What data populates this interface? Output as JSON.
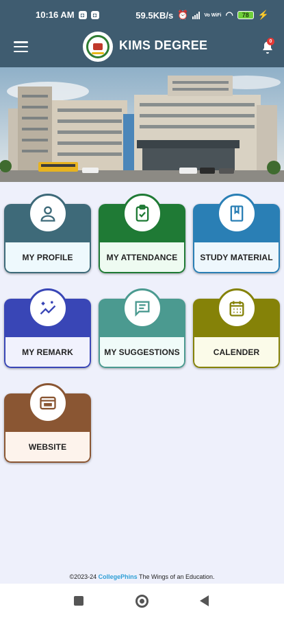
{
  "status_bar": {
    "time": "10:16 AM",
    "network_speed": "59.5KB/s",
    "network_type": "Vo WiFi",
    "battery": "78"
  },
  "app_bar": {
    "title": "KIMS DEGREE",
    "notification_count": "0"
  },
  "tiles": [
    {
      "label": "MY PROFILE",
      "icon": "person-icon",
      "color": "#3e6a79",
      "light": "#eef9fd"
    },
    {
      "label": "MY ATTENDANCE",
      "icon": "clipboard-check-icon",
      "color": "#1f7a35",
      "light": "#eefbf1"
    },
    {
      "label": "STUDY MATERIAL",
      "icon": "book-icon",
      "color": "#2a7fb5",
      "light": "#eef7fd"
    },
    {
      "label": "MY REMARK",
      "icon": "trend-sparkle-icon",
      "color": "#3946b6",
      "light": "#f1f2fd"
    },
    {
      "label": "MY SUGGESTIONS",
      "icon": "chat-icon",
      "color": "#4b9a90",
      "light": "#f0fbf9"
    },
    {
      "label": "CALENDER",
      "icon": "calendar-icon",
      "color": "#858208",
      "light": "#fbfbe9"
    },
    {
      "label": "WEBSITE",
      "icon": "browser-icon",
      "color": "#8a5633",
      "light": "#fdf3ec"
    }
  ],
  "footer": {
    "prefix": "©2023-24 ",
    "brand": "CollegePhins",
    "suffix": " The Wings of an Education."
  }
}
